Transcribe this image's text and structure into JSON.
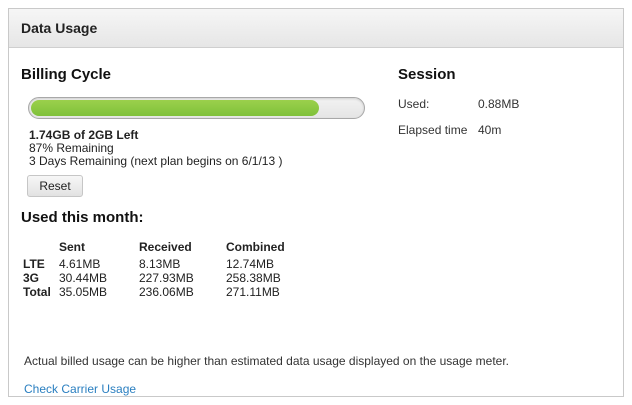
{
  "panel": {
    "title": "Data Usage"
  },
  "billing_cycle": {
    "heading": "Billing Cycle",
    "progress_fraction": 0.87,
    "left_summary": "1.74GB of 2GB Left",
    "percent_remaining": "87% Remaining",
    "days_remaining": "3 Days Remaining (next plan begins on 6/1/13 )",
    "reset_label": "Reset"
  },
  "used_this_month": {
    "heading": "Used this month:",
    "columns": [
      "",
      "Sent",
      "Received",
      "Combined"
    ],
    "rows": [
      {
        "label": "LTE",
        "sent": "4.61MB",
        "received": "8.13MB",
        "combined": "12.74MB"
      },
      {
        "label": "3G",
        "sent": "30.44MB",
        "received": "227.93MB",
        "combined": "258.38MB"
      },
      {
        "label": "Total",
        "sent": "35.05MB",
        "received": "236.06MB",
        "combined": "271.11MB"
      }
    ]
  },
  "session": {
    "heading": "Session",
    "used_label": "Used:",
    "used_value": "0.88MB",
    "elapsed_label": "Elapsed time",
    "elapsed_value": "40m"
  },
  "footer": {
    "note": "Actual billed usage can be higher than estimated data usage displayed on the usage meter.",
    "link_label": "Check Carrier Usage"
  },
  "colors": {
    "progress_fill": "#7fc13a",
    "link": "#2a7fc0"
  }
}
